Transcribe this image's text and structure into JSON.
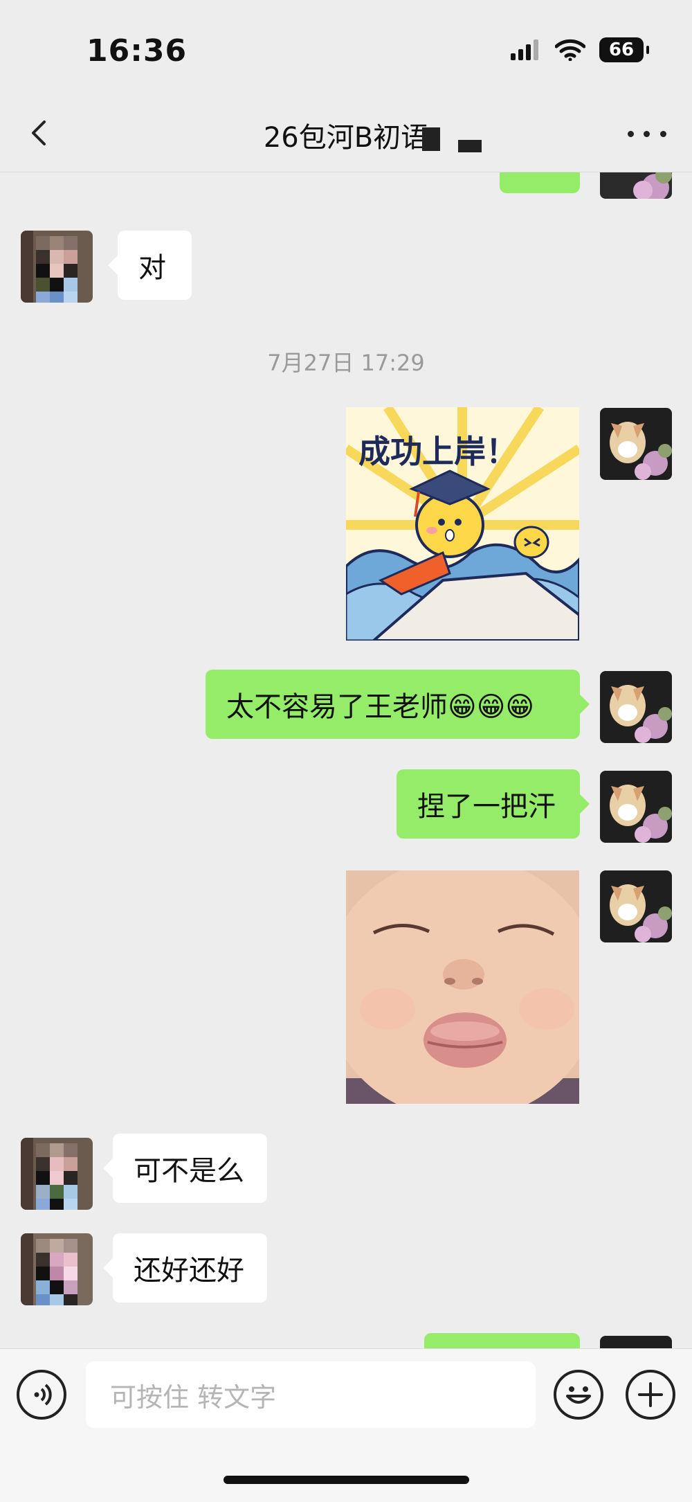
{
  "status_bar": {
    "time": "16:36",
    "battery": "66"
  },
  "header": {
    "title": "26包河B初语",
    "back_icon": "chevron-left-icon",
    "more_icon": "more-dots-icon"
  },
  "messages": [
    {
      "side": "right",
      "type": "text",
      "text": "",
      "partial": true
    },
    {
      "side": "left",
      "type": "text",
      "text": "对"
    },
    {
      "type": "timestamp",
      "text": "7月27日 17:29"
    },
    {
      "side": "right",
      "type": "sticker",
      "text": "成功上岸！"
    },
    {
      "side": "right",
      "type": "text",
      "text": "太不容易了王老师😁😁😁"
    },
    {
      "side": "right",
      "type": "text",
      "text": "捏了一把汗"
    },
    {
      "side": "right",
      "type": "sticker",
      "text": ""
    },
    {
      "side": "left",
      "type": "text",
      "text": "可不是么"
    },
    {
      "side": "left",
      "type": "text",
      "text": "还好还好"
    },
    {
      "side": "right",
      "type": "text",
      "text": "",
      "partial": true
    }
  ],
  "input_bar": {
    "placeholder": "可按住 转文字",
    "voice_icon": "voice-icon",
    "emoji_icon": "emoji-icon",
    "plus_icon": "plus-icon"
  },
  "colors": {
    "background": "#ededed",
    "bubble_self": "#95ec69",
    "bubble_other": "#ffffff"
  }
}
